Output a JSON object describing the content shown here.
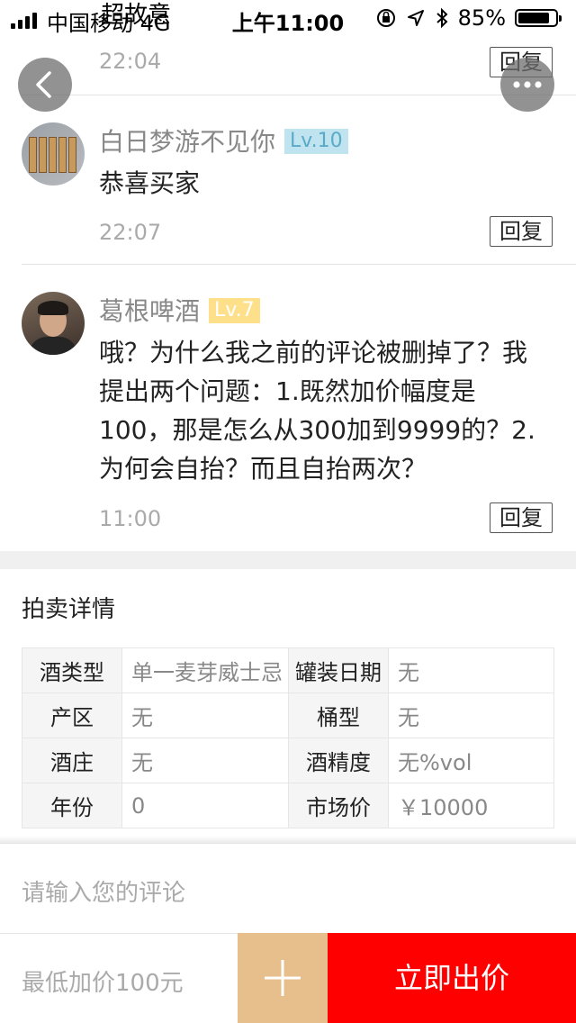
{
  "status_bar": {
    "carrier": "中国移动 4G",
    "overlay_text": "超故意",
    "time": "上午11:00",
    "battery": "85%",
    "battery_level": 0.85
  },
  "comments": [
    {
      "time": "22:04",
      "reply_label": "回复"
    },
    {
      "username": "白日梦游不见你",
      "level": "Lv.10",
      "text": "恭喜买家",
      "time": "22:07",
      "reply_label": "回复"
    },
    {
      "username": "葛根啤酒",
      "level": "Lv.7",
      "text": "哦？为什么我之前的评论被删掉了？我提出两个问题：1.既然加价幅度是100，那是怎么从300加到9999的？2.为何会自抬？而且自抬两次？",
      "time": "11:00",
      "reply_label": "回复"
    }
  ],
  "auction_details": {
    "title": "拍卖详情",
    "rows": [
      [
        {
          "k": "酒类型",
          "v": "单一麦芽威士忌"
        },
        {
          "k": "罐装日期",
          "v": "无"
        }
      ],
      [
        {
          "k": "产区",
          "v": "无"
        },
        {
          "k": "桶型",
          "v": "无"
        }
      ],
      [
        {
          "k": "酒庄",
          "v": "无"
        },
        {
          "k": "酒精度",
          "v": "无%vol"
        }
      ],
      [
        {
          "k": "年份",
          "v": "0"
        },
        {
          "k": "市场价",
          "v": "￥10000"
        }
      ]
    ]
  },
  "bottom": {
    "comment_placeholder": "请输入您的评论",
    "bid_placeholder": "最低加价100元",
    "bid_button": "立即出价"
  },
  "colors": {
    "bid_red": "#ff0000",
    "plus_tan": "#e6bf8c",
    "lv10_blue": "#bfe4f0",
    "lv7_yellow": "#ffe08a"
  },
  "icons": {
    "back": "chevron-left-icon",
    "more": "more-dots-icon",
    "plus": "plus-icon"
  }
}
